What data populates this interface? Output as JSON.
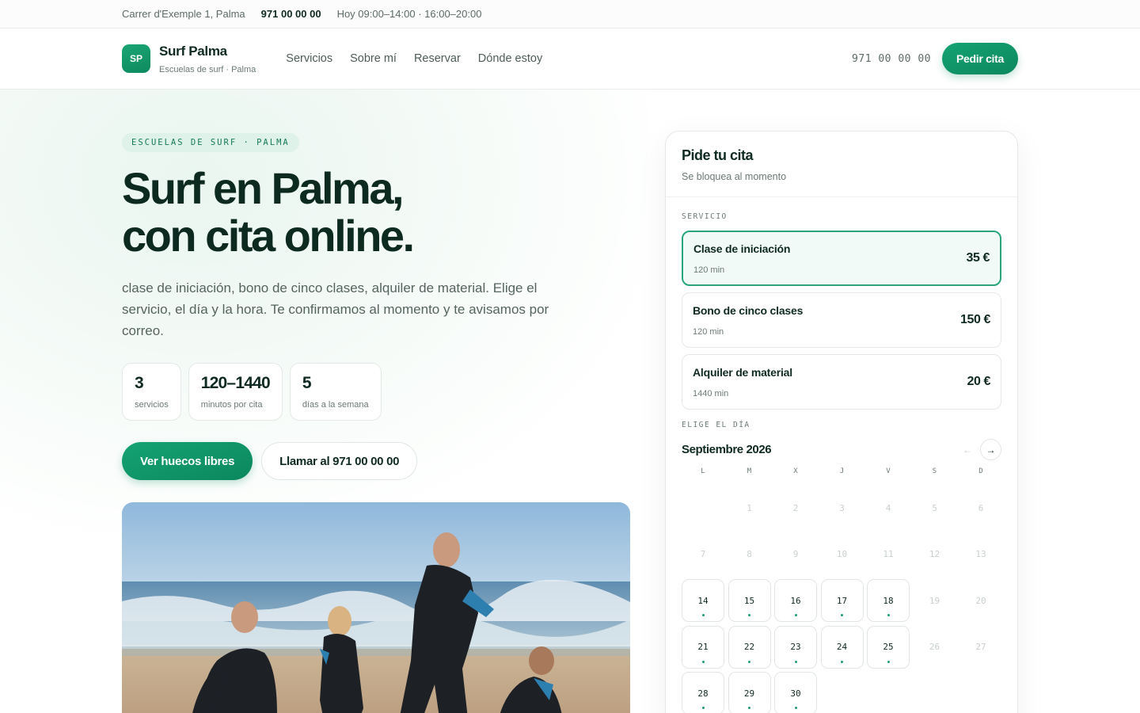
{
  "topbar": {
    "address": "Carrer d'Exemple 1, Palma",
    "phone": "971 00 00 00",
    "hours": "Hoy 09:00–14:00 · 16:00–20:00"
  },
  "nav": {
    "logo": "SP",
    "brand_name": "Surf Palma",
    "brand_sub": "Escuelas de surf · Palma",
    "links": [
      "Servicios",
      "Sobre mí",
      "Reservar",
      "Dónde estoy"
    ],
    "phone": "971 00 00 00",
    "cta": "Pedir cita"
  },
  "hero": {
    "badge": "ESCUELAS DE SURF · PALMA",
    "title_line1": "Surf en Palma,",
    "title_line2": "con cita online.",
    "description": "clase de iniciación, bono de cinco clases, alquiler de material. Elige el servicio, el día y la hora. Te confirmamos al momento y te avisamos por correo.",
    "stats": [
      {
        "value": "3",
        "label": "servicios"
      },
      {
        "value": "120–1440",
        "label": "minutos por cita"
      },
      {
        "value": "5",
        "label": "días a la semana"
      }
    ],
    "cta_primary": "Ver huecos libres",
    "cta_secondary": "Llamar al 971 00 00 00"
  },
  "booking": {
    "title": "Pide tu cita",
    "subtitle": "Se bloquea al momento",
    "service_label": "SERVICIO",
    "services": [
      {
        "name": "Clase de iniciación",
        "duration": "120 min",
        "price": "35 €",
        "selected": true
      },
      {
        "name": "Bono de cinco clases",
        "duration": "120 min",
        "price": "150 €",
        "selected": false
      },
      {
        "name": "Alquiler de material",
        "duration": "1440 min",
        "price": "20 €",
        "selected": false
      }
    ],
    "day_label": "ELIGE EL DÍA",
    "month": "Septiembre 2026",
    "prev_icon": "←",
    "next_icon": "→",
    "weekdays": [
      "L",
      "M",
      "X",
      "J",
      "V",
      "S",
      "D"
    ],
    "available_days": [
      14,
      15,
      16,
      17,
      18,
      21,
      22,
      23,
      24,
      25,
      28,
      29,
      30
    ]
  }
}
